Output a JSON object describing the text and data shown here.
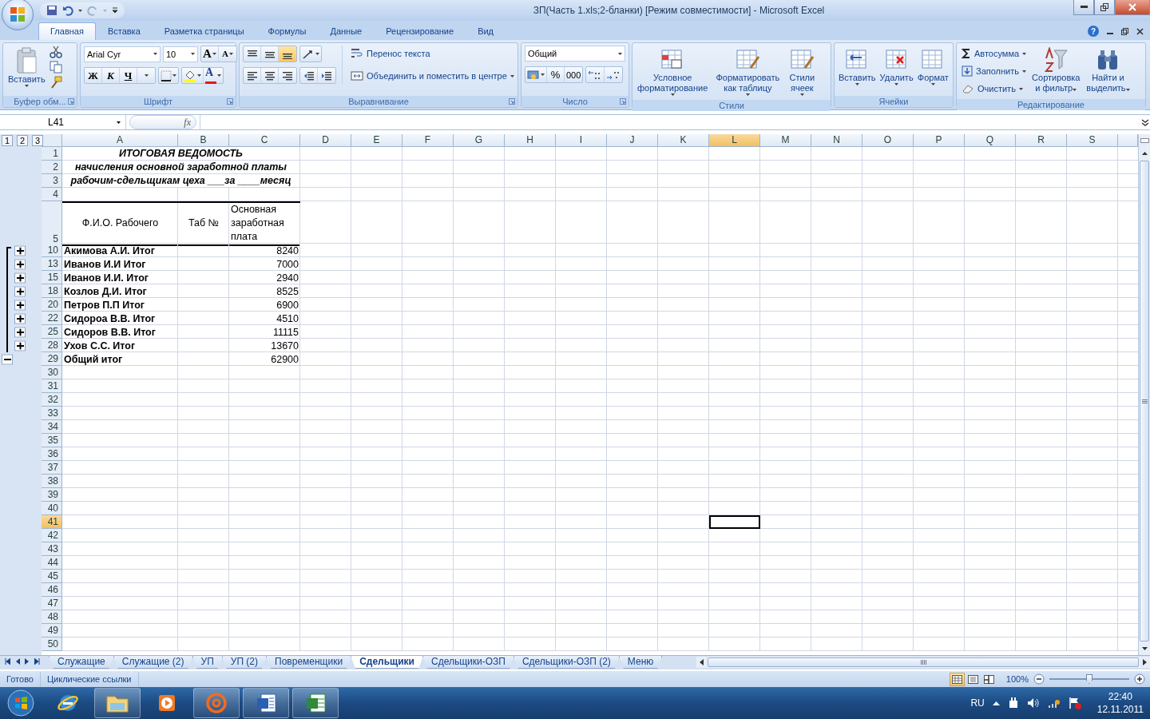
{
  "window": {
    "title": "ЗП(Часть 1.xls;2-бланки)  [Режим совместимости] - Microsoft Excel",
    "help": "?"
  },
  "ribbon_tabs": [
    {
      "label": "Главная",
      "selected": true
    },
    {
      "label": "Вставка",
      "selected": false
    },
    {
      "label": "Разметка страницы",
      "selected": false
    },
    {
      "label": "Формулы",
      "selected": false
    },
    {
      "label": "Данные",
      "selected": false
    },
    {
      "label": "Рецензирование",
      "selected": false
    },
    {
      "label": "Вид",
      "selected": false
    }
  ],
  "clipboard": {
    "label": "Буфер обм...",
    "paste": "Вставить"
  },
  "font": {
    "label": "Шрифт",
    "name": "Arial Cyr",
    "size": "10",
    "grow": "A",
    "shrink": "A",
    "bold": "Ж",
    "italic": "К",
    "underline": "Ч",
    "font_color_label": "A"
  },
  "alignment": {
    "label": "Выравнивание",
    "vertical": [
      {
        "selected": false
      },
      {
        "selected": false
      },
      {
        "selected": true
      }
    ],
    "wrap": "Перенос текста",
    "merge": "Объединить и поместить в центре"
  },
  "number": {
    "label": "Число",
    "format": "Общий",
    "percent": "%",
    "thousands": "000"
  },
  "styles": {
    "label": "Стили",
    "buttons": [
      "Условное\nформатирование",
      "Форматировать\nкак таблицу",
      "Стили\nячеек"
    ]
  },
  "cells_group": {
    "label": "Ячейки",
    "buttons": [
      "Вставить",
      "Удалить",
      "Формат"
    ]
  },
  "editing": {
    "label": "Редактирование",
    "small": [
      "Автосумма",
      "Заполнить",
      "Очистить"
    ],
    "large": [
      "Сортировка\nи фильтр",
      "Найти и\nвыделить"
    ]
  },
  "formula_bar": {
    "name_box": "L41",
    "function_label": "fx"
  },
  "outline_levels": [
    "1",
    "2",
    "3"
  ],
  "columns": [
    {
      "label": "A",
      "selected": false
    },
    {
      "label": "B",
      "selected": false
    },
    {
      "label": "C",
      "selected": false
    },
    {
      "label": "D",
      "selected": false
    },
    {
      "label": "E",
      "selected": false
    },
    {
      "label": "F",
      "selected": false
    },
    {
      "label": "G",
      "selected": false
    },
    {
      "label": "H",
      "selected": false
    },
    {
      "label": "I",
      "selected": false
    },
    {
      "label": "J",
      "selected": false
    },
    {
      "label": "K",
      "selected": false
    },
    {
      "label": "L",
      "selected": true
    },
    {
      "label": "M",
      "selected": false
    },
    {
      "label": "N",
      "selected": false
    },
    {
      "label": "O",
      "selected": false
    },
    {
      "label": "P",
      "selected": false
    },
    {
      "label": "Q",
      "selected": false
    },
    {
      "label": "R",
      "selected": false
    },
    {
      "label": "S",
      "selected": false
    }
  ],
  "rows": [
    {
      "num": "1",
      "kind": "title",
      "selected": false,
      "text": "ИТОГОВАЯ ВЕДОМОСТЬ"
    },
    {
      "num": "2",
      "kind": "title",
      "selected": false,
      "text": "начисления основной заработной платы"
    },
    {
      "num": "3",
      "kind": "title",
      "selected": false,
      "text": "рабочим-сдельщикам цеха ___за ____месяц"
    },
    {
      "num": "4",
      "kind": "empty",
      "selected": false
    },
    {
      "num": "5",
      "kind": "header",
      "selected": false,
      "cells": [
        "Ф.И.О. Рабочего",
        "Таб №",
        "Основная заработная плата"
      ]
    },
    {
      "num": "10",
      "kind": "data",
      "selected": false,
      "group_collapsed": true,
      "name": "Акимова А.И. Итог",
      "amount": "8240"
    },
    {
      "num": "13",
      "kind": "data",
      "selected": false,
      "group_collapsed": true,
      "name": "Иванов И.И Итог",
      "amount": "7000"
    },
    {
      "num": "15",
      "kind": "data",
      "selected": false,
      "group_collapsed": true,
      "name": "Иванов И.И. Итог",
      "amount": "2940"
    },
    {
      "num": "18",
      "kind": "data",
      "selected": false,
      "group_collapsed": true,
      "name": "Козлов Д.И. Итог",
      "amount": "8525"
    },
    {
      "num": "20",
      "kind": "data",
      "selected": false,
      "group_collapsed": true,
      "name": "Петров П.П Итог",
      "amount": "6900"
    },
    {
      "num": "22",
      "kind": "data",
      "selected": false,
      "group_collapsed": true,
      "name": "Сидороа В.В. Итог",
      "amount": "4510"
    },
    {
      "num": "25",
      "kind": "data",
      "selected": false,
      "group_collapsed": true,
      "name": "Сидоров В.В. Итог",
      "amount": "11115"
    },
    {
      "num": "28",
      "kind": "data",
      "selected": false,
      "group_collapsed": true,
      "name": "Ухов С.С. Итог",
      "amount": "13670"
    },
    {
      "num": "29",
      "kind": "data",
      "selected": false,
      "group_collapsed": false,
      "name": "Общий итог",
      "amount": "62900"
    },
    {
      "num": "30",
      "kind": "empty",
      "selected": false
    },
    {
      "num": "31",
      "kind": "empty",
      "selected": false
    },
    {
      "num": "32",
      "kind": "empty",
      "selected": false
    },
    {
      "num": "33",
      "kind": "empty",
      "selected": false
    },
    {
      "num": "34",
      "kind": "empty",
      "selected": false
    },
    {
      "num": "35",
      "kind": "empty",
      "selected": false
    },
    {
      "num": "36",
      "kind": "empty",
      "selected": false
    },
    {
      "num": "37",
      "kind": "empty",
      "selected": false
    },
    {
      "num": "38",
      "kind": "empty",
      "selected": false
    },
    {
      "num": "39",
      "kind": "empty",
      "selected": false
    },
    {
      "num": "40",
      "kind": "empty",
      "selected": false
    },
    {
      "num": "41",
      "kind": "empty",
      "selected": true
    },
    {
      "num": "42",
      "kind": "empty",
      "selected": false
    },
    {
      "num": "43",
      "kind": "empty",
      "selected": false
    },
    {
      "num": "44",
      "kind": "empty",
      "selected": false
    },
    {
      "num": "45",
      "kind": "empty",
      "selected": false
    },
    {
      "num": "46",
      "kind": "empty",
      "selected": false
    },
    {
      "num": "47",
      "kind": "empty",
      "selected": false
    },
    {
      "num": "48",
      "kind": "empty",
      "selected": false
    },
    {
      "num": "49",
      "kind": "empty",
      "selected": false
    },
    {
      "num": "50",
      "kind": "empty",
      "selected": false
    }
  ],
  "sheet_tabs": [
    {
      "label": "Служащие",
      "selected": false
    },
    {
      "label": "Служащие (2)",
      "selected": false
    },
    {
      "label": "УП",
      "selected": false
    },
    {
      "label": "УП (2)",
      "selected": false
    },
    {
      "label": "Повременщики",
      "selected": false
    },
    {
      "label": "Сдельщики",
      "selected": true
    },
    {
      "label": "Сдельщики-ОЗП",
      "selected": false
    },
    {
      "label": "Сдельщики-ОЗП (2)",
      "selected": false
    },
    {
      "label": "Меню",
      "selected": false
    }
  ],
  "status_bar": {
    "items": [
      "Готово",
      "Циклические ссылки"
    ],
    "views": [
      {
        "selected": true
      },
      {
        "selected": false
      },
      {
        "selected": false
      }
    ],
    "zoom": {
      "reading": "100%",
      "level": 0.5
    }
  },
  "taskbar": {
    "apps": [
      {
        "open": false
      },
      {
        "open": true
      },
      {
        "open": false
      },
      {
        "open": true
      },
      {
        "open": true
      },
      {
        "open": true
      }
    ],
    "language": "RU",
    "time": "22:40",
    "date": "12.11.2011"
  }
}
